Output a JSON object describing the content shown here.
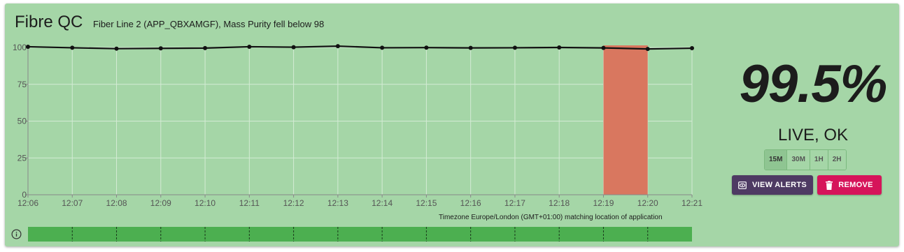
{
  "header": {
    "title": "Fibre QC",
    "subtitle": "Fiber Line 2 (APP_QBXAMGF), Mass Purity fell below 98"
  },
  "timezone_note": "Timezone Europe/London (GMT+01:00) matching location of application",
  "summary": {
    "value": "99.5%",
    "status": "LIVE, OK"
  },
  "range_selector": {
    "options": [
      "15M",
      "30M",
      "1H",
      "2H"
    ],
    "selected": "15M"
  },
  "actions": {
    "view_alerts_label": "VIEW ALERTS",
    "remove_label": "REMOVE"
  },
  "icons": {
    "info": "info-circle-icon",
    "view_alerts": "eye-icon",
    "remove": "trash-icon"
  },
  "colors": {
    "card_bg": "#a5d6a7",
    "line": "#111111",
    "alert_band": "#d9775f",
    "status_bar": "#4caf50",
    "view_alerts_btn": "#4e3a63",
    "remove_btn": "#d6145a"
  },
  "chart_data": {
    "type": "line",
    "x": [
      "12:06",
      "12:07",
      "12:08",
      "12:09",
      "12:10",
      "12:11",
      "12:12",
      "12:13",
      "12:14",
      "12:15",
      "12:16",
      "12:17",
      "12:18",
      "12:19",
      "12:20",
      "12:21"
    ],
    "series": [
      {
        "values": [
          100.5,
          99.8,
          99.2,
          99.4,
          99.6,
          100.5,
          100.2,
          100.9,
          99.8,
          99.9,
          99.7,
          99.8,
          100.0,
          99.7,
          99.0,
          99.5
        ]
      }
    ],
    "ylim": [
      0,
      100
    ],
    "yticks": [
      0,
      25,
      50,
      75,
      100
    ],
    "alert_band": {
      "from": "12:19",
      "to": "12:20"
    },
    "status_timeline": {
      "segments": 15,
      "state": "OK"
    },
    "grid": true
  }
}
